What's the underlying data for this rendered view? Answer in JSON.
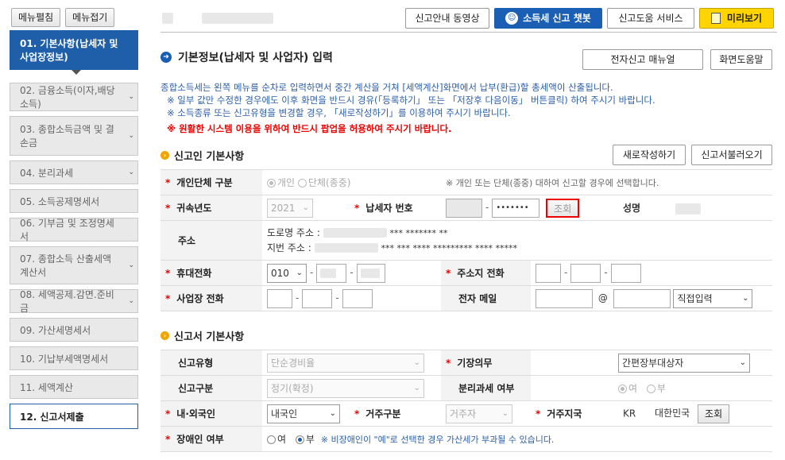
{
  "sidebar": {
    "expand_label": "메뉴펼침",
    "collapse_label": "메뉴접기",
    "items": [
      {
        "label": "01. 기본사항(납세자 및 사업장정보)"
      },
      {
        "label": "02. 금융소득(이자,배당소득)"
      },
      {
        "label": "03. 종합소득금액 및 결손금"
      },
      {
        "label": "04. 분리과세"
      },
      {
        "label": "05. 소득공제명세서"
      },
      {
        "label": "06. 기부금 및 조정명세서"
      },
      {
        "label": "07. 종합소득 산출세액계산서"
      },
      {
        "label": "08. 세액공제.감면.준비금"
      },
      {
        "label": "09. 가산세명세서"
      },
      {
        "label": "10. 기납부세액명세서"
      },
      {
        "label": "11. 세액계산"
      },
      {
        "label": "12. 신고서제출"
      }
    ]
  },
  "topbar": {
    "guide_video": "신고안내 동영상",
    "chatbot": "소득세 신고 챗봇",
    "help_service": "신고도움 서비스",
    "preview": "미리보기"
  },
  "page": {
    "title": "기본정보(납세자 및 사업자) 입력",
    "manual_button": "전자신고 매뉴얼",
    "help_button": "화면도움말",
    "notes": [
      "종합소득세는 왼쪽 메뉴를 순차로 입력하면서 중간 계산을 거쳐 [세액계산]화면에서 납부(환급)할 총세액이 산출됩니다.",
      "※ 일부 값만 수정한 경우에도 이후 화면을 반드시 경유(「등록하기」 또는 「저장후 다음이동」 버튼클릭) 하여 주시기 바랍니다.",
      "※ 소득종류 또는 신고유형을 변경할 경우, 「새로작성하기」를 이용하여 주시기 바랍니다."
    ],
    "warning": "※ 원활한 시스템 이용을 위하여 반드시 팝업을 허용하여 주시기 바랍니다."
  },
  "reporter": {
    "section_title": "신고인 기본사항",
    "new_button": "새로작성하기",
    "load_button": "신고서불러오기",
    "type_label": "개인단체 구분",
    "type_individual": "개인",
    "type_group": "단체(종중)",
    "type_note": "※ 개인 또는 단체(종중) 대하여 신고할 경우에 선택합니다.",
    "year_label": "귀속년도",
    "year_value": "2021",
    "taxid_label": "납세자 번호",
    "taxid_masked": "•••••••",
    "lookup_button": "조회",
    "name_label": "성명",
    "address_label": "주소",
    "road_address_label": "도로명 주소 :",
    "road_address_masked": "*** ******* **",
    "lot_address_label": "지번 주소 :",
    "lot_address_masked": "*** *** **** ********* **** *****",
    "mobile_label": "휴대전화",
    "mobile_prefix": "010",
    "home_phone_label": "주소지 전화",
    "biz_phone_label": "사업장 전화",
    "email_label": "전자 메일",
    "email_at": "@",
    "email_domain": "직접입력"
  },
  "report": {
    "section_title": "신고서 기본사항",
    "type_label": "신고유형",
    "type_value": "단순경비율",
    "bookkeeping_label": "기장의무",
    "bookkeeping_value": "간편장부대상자",
    "category_label": "신고구분",
    "category_value": "정기(확정)",
    "separate_tax_label": "분리과세 여부",
    "separate_yes": "여",
    "separate_no": "부",
    "nationality_label": "내·외국인",
    "nationality_value": "내국인",
    "residency_label": "거주구분",
    "residency_value": "거주자",
    "region_label": "거주지국",
    "region_code": "KR",
    "region_name": "대한민국",
    "region_lookup": "조회",
    "disabled_label": "장애인 여부",
    "disabled_yes": "여",
    "disabled_no": "부",
    "disabled_note": "※ 비장애인이 \"예\"로 선택한 경우 가산세가 부과될 수 있습니다."
  }
}
